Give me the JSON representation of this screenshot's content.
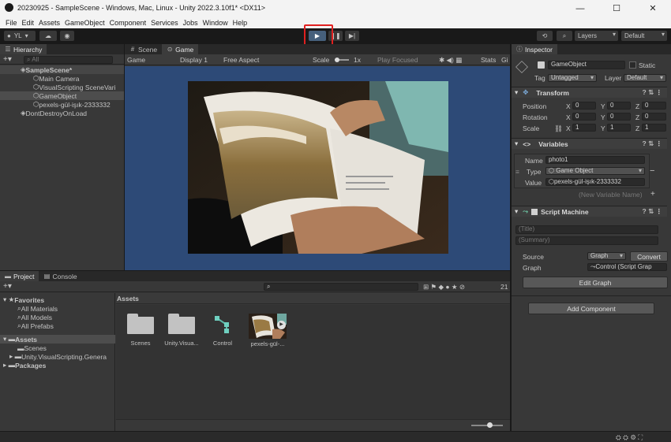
{
  "window": {
    "title": "20230925 - SampleScene - Windows, Mac, Linux - Unity 2022.3.10f1* <DX11>",
    "controls": [
      "—",
      "☐",
      "✕"
    ]
  },
  "menu": [
    "File",
    "Edit",
    "Assets",
    "GameObject",
    "Component",
    "Services",
    "Jobs",
    "Window",
    "Help"
  ],
  "toolbar": {
    "account": "YL",
    "layers": "Layers",
    "layout": "Default"
  },
  "hierarchy": {
    "tab": "Hierarchy",
    "search_placeholder": "All",
    "items": [
      {
        "label": "SampleScene*"
      },
      {
        "label": "Main Camera"
      },
      {
        "label": "VisualScripting SceneVari"
      },
      {
        "label": "GameObject"
      },
      {
        "label": "pexels-gül-işık-2333332"
      },
      {
        "label": "DontDestroyOnLoad"
      }
    ]
  },
  "scene_tabs": {
    "scene": "Scene",
    "game": "Game"
  },
  "game_bar": {
    "mode": "Game",
    "display": "Display 1",
    "aspect": "Free Aspect",
    "scale_label": "Scale",
    "scale_value": "1x",
    "play_focused": "Play Focused",
    "stats": "Stats",
    "gizmos": "Gi"
  },
  "project": {
    "tab_project": "Project",
    "tab_console": "Console",
    "favorites": "Favorites",
    "fav_items": [
      "All Materials",
      "All Models",
      "All Prefabs"
    ],
    "assets_root": "Assets",
    "asset_tree": [
      "Scenes",
      "Unity.VisualScripting.Genera"
    ],
    "packages": "Packages",
    "header": "Assets",
    "count": "21",
    "assets": [
      {
        "label": "Scenes"
      },
      {
        "label": "Unity.Visua..."
      },
      {
        "label": "Control"
      },
      {
        "label": "pexels-gül-..."
      }
    ]
  },
  "inspector": {
    "tab": "Inspector",
    "name": "GameObject",
    "static": "Static",
    "tag_label": "Tag",
    "tag_value": "Untagged",
    "layer_label": "Layer",
    "layer_value": "Default",
    "transform": {
      "title": "Transform",
      "rows": [
        {
          "label": "Position",
          "x": "0",
          "y": "0",
          "z": "0"
        },
        {
          "label": "Rotation",
          "x": "0",
          "y": "0",
          "z": "0"
        },
        {
          "label": "Scale",
          "x": "1",
          "y": "1",
          "z": "1"
        }
      ]
    },
    "variables": {
      "title": "Variables",
      "name_label": "Name",
      "name_value": "photo1",
      "type_label": "Type",
      "type_value": "Game Object",
      "value_label": "Value",
      "value_value": "pexels-gül-işık-2333332",
      "new_placeholder": "(New Variable Name)"
    },
    "script_machine": {
      "title": "Script Machine",
      "title_placeholder": "(Title)",
      "summary_placeholder": "(Summary)",
      "source_label": "Source",
      "source_value": "Graph",
      "convert": "Convert",
      "graph_label": "Graph",
      "graph_value": "Control (Script Grap",
      "edit_graph": "Edit Graph"
    },
    "add_component": "Add Component"
  }
}
